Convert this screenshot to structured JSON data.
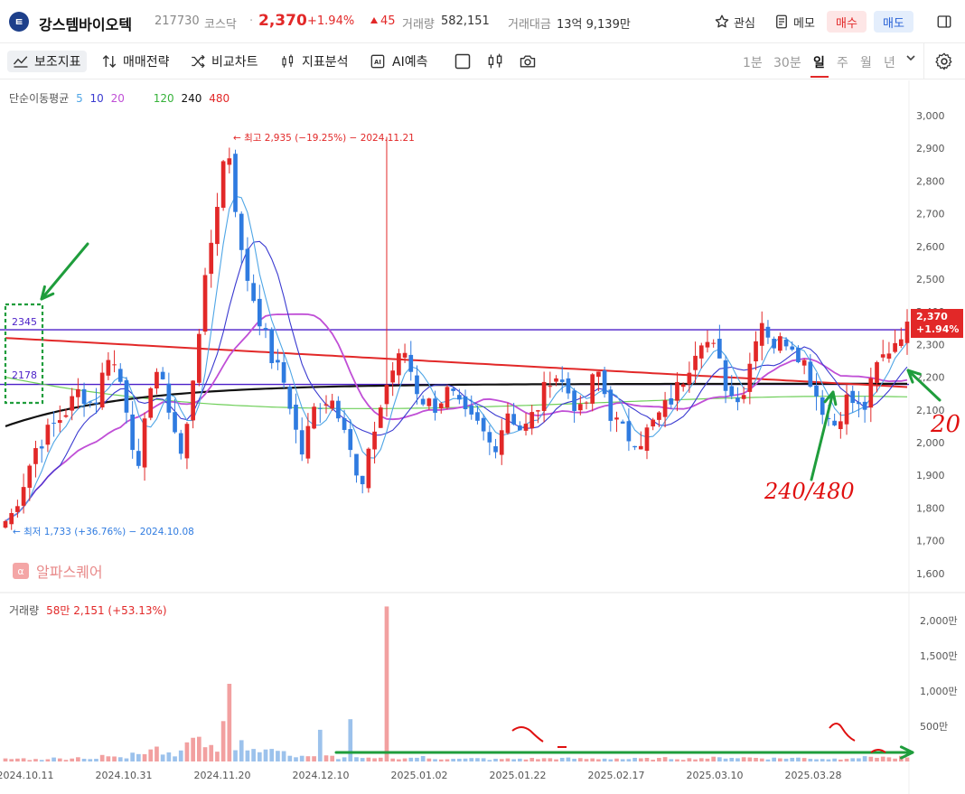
{
  "header": {
    "logo_text": "ㅌ",
    "name": "강스템바이오텍",
    "code": "217730",
    "market": "코스닥",
    "separator": "·",
    "price": "2,370",
    "change_pct": "+1.94%",
    "change_abs": "45",
    "volume_label": "거래량",
    "volume_value": "582,151",
    "amount_label": "거래대금",
    "amount_value": "13억 9,139만",
    "fav_label": "관심",
    "memo_label": "메모",
    "buy_label": "매수",
    "sell_label": "매도"
  },
  "toolbar": {
    "indicator_label": "보조지표",
    "strategy_label": "매매전략",
    "compare_label": "비교차트",
    "analysis_label": "지표분석",
    "ai_label": "AI예측",
    "periods": [
      "1분",
      "30분",
      "일",
      "주",
      "월",
      "년"
    ],
    "active_period": "일"
  },
  "legend": {
    "title": "단순이동평균",
    "ma": [
      {
        "label": "5",
        "color": "#4fa6e6"
      },
      {
        "label": "10",
        "color": "#3a3ad0"
      },
      {
        "label": "20",
        "color": "#c04fd6"
      },
      {
        "label": "120",
        "color": "#36b23a"
      },
      {
        "label": "240",
        "color": "#111111"
      },
      {
        "label": "480",
        "color": "#e22828"
      }
    ],
    "volume_title": "거래량",
    "volume_value": "58만 2,151 (+53.13%)"
  },
  "watermark": "알파스퀘어",
  "watermark_logo": "α",
  "annotations": {
    "high": "← 최고 2,935 (−19.25%) − 2024.11.21",
    "low": "← 최저 1,733 (+36.76%) − 2024.10.08",
    "line_2345": "2345",
    "line_2178": "2178",
    "hand_240_480": "240/480",
    "hand_20": "20"
  },
  "current_tag": {
    "price": "2,370",
    "pct": "+1.94%"
  },
  "colors": {
    "up": "#e22828",
    "down": "#2f7be0",
    "vol_up": "#f2a0a0",
    "vol_down": "#9cc2ec",
    "hline": "#4b1fc8",
    "annot": "#1f9d3c",
    "hand": "#e01010"
  },
  "chart_data": {
    "type": "candlestick",
    "price_axis": {
      "ticks": [
        "3,000",
        "2,900",
        "2,800",
        "2,700",
        "2,600",
        "2,500",
        "2,400",
        "2,300",
        "2,200",
        "2,100",
        "2,000",
        "1,900",
        "1,800",
        "1,700",
        "1,600"
      ],
      "ylim": [
        1600,
        3000
      ]
    },
    "volume_axis": {
      "ticks": [
        "2,000만",
        "1,500만",
        "1,000만",
        "500만"
      ],
      "ylim": [
        0,
        2000
      ]
    },
    "date_labels": [
      "2024.10.11",
      "2024.10.31",
      "2024.11.20",
      "2024.12.10",
      "2025.01.02",
      "2025.01.22",
      "2025.02.17",
      "2025.03.10",
      "2025.03.28"
    ],
    "horizontal_lines": [
      2345,
      2178
    ],
    "anchors": [
      1733,
      1850,
      1980,
      2040,
      2090,
      2160,
      2110,
      2280,
      2160,
      1900,
      2250,
      2120,
      1940,
      2320,
      2640,
      2935,
      2560,
      2410,
      2260,
      2170,
      1960,
      2120,
      2140,
      2060,
      1830,
      2050,
      2210,
      2280,
      2140,
      2110,
      2160,
      2080,
      2050,
      1980,
      2100,
      2030,
      2110,
      2220,
      2160,
      2080,
      2230,
      2080,
      2020,
      2010,
      2070,
      2130,
      2210,
      2330,
      2280,
      2140,
      2160,
      2390,
      2300,
      2320,
      2250,
      2130,
      2050,
      2140,
      2090,
      2240,
      2300,
      2370
    ],
    "volume_anchors": [
      35,
      40,
      30,
      45,
      38,
      55,
      40,
      70,
      50,
      150,
      230,
      120,
      200,
      380,
      180,
      800,
      240,
      190,
      160,
      110,
      80,
      60,
      70,
      50,
      45,
      40,
      35,
      50,
      60,
      40,
      45,
      35,
      40,
      30,
      35,
      38,
      40,
      45,
      42,
      38,
      40,
      42,
      35,
      38,
      40,
      45,
      38,
      48,
      50,
      60,
      55,
      52,
      45,
      50,
      48,
      40,
      38,
      60,
      55,
      70,
      50,
      58
    ],
    "ma_lines": [
      "5",
      "10",
      "20",
      "120",
      "240",
      "480"
    ]
  }
}
